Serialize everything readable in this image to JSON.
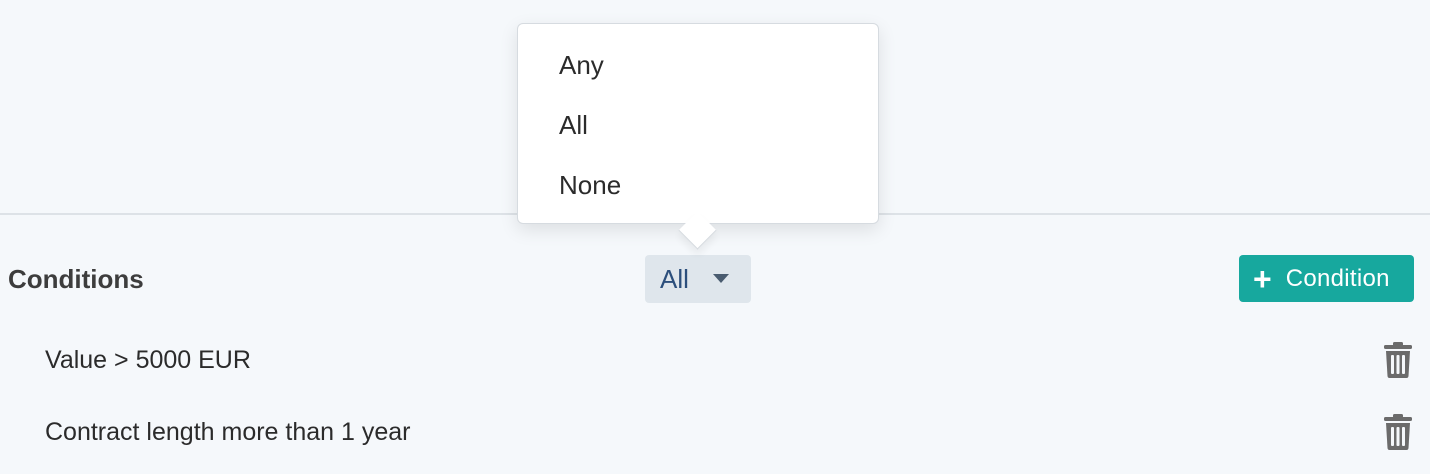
{
  "conditions": {
    "title": "Conditions",
    "mode_selected": "All",
    "add_button_label": "Condition",
    "add_button_icon": "plus-icon",
    "delete_icon": "trash-icon",
    "items": [
      {
        "label": "Value > 5000 EUR"
      },
      {
        "label": "Contract length more than 1 year"
      }
    ]
  },
  "mode_menu": {
    "options": [
      "Any",
      "All",
      "None"
    ]
  },
  "colors": {
    "background": "#f5f8fb",
    "accent_button": "#17a89e",
    "select_background": "#dfe6ec",
    "select_text": "#2c4f7c",
    "divider": "#dde2e7"
  }
}
